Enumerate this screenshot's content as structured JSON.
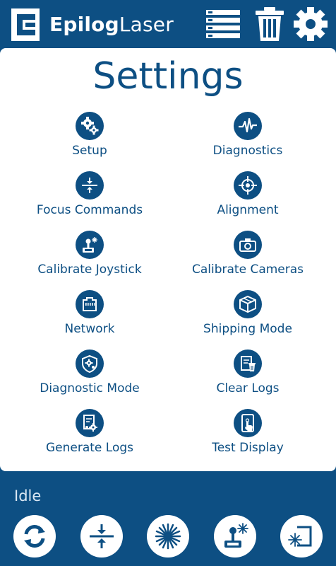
{
  "header": {
    "brand_bold": "Epilog",
    "brand_light": "Laser",
    "logo_icon": "epilog-logo",
    "buttons": [
      {
        "icon": "list-icon"
      },
      {
        "icon": "trash-icon"
      },
      {
        "icon": "gear-icon"
      }
    ]
  },
  "settings": {
    "title": "Settings",
    "items": [
      {
        "label": "Setup",
        "icon": "setup-gears-icon"
      },
      {
        "label": "Diagnostics",
        "icon": "pulse-icon"
      },
      {
        "label": "Focus Commands",
        "icon": "focus-arrows-icon"
      },
      {
        "label": "Alignment",
        "icon": "crosshair-icon"
      },
      {
        "label": "Calibrate Joystick",
        "icon": "joystick-icon"
      },
      {
        "label": "Calibrate Cameras",
        "icon": "camera-icon"
      },
      {
        "label": "Network",
        "icon": "ethernet-port-icon"
      },
      {
        "label": "Shipping Mode",
        "icon": "box-icon"
      },
      {
        "label": "Diagnostic Mode",
        "icon": "shield-gear-icon"
      },
      {
        "label": "Clear Logs",
        "icon": "clear-logs-icon"
      },
      {
        "label": "Generate Logs",
        "icon": "generate-logs-icon"
      },
      {
        "label": "Test Display",
        "icon": "touch-display-icon"
      }
    ]
  },
  "status": {
    "text": "Idle"
  },
  "bottom_bar": [
    {
      "icon": "refresh-icon"
    },
    {
      "icon": "focus-icon"
    },
    {
      "icon": "laser-icon"
    },
    {
      "icon": "joystick-laser-icon"
    },
    {
      "icon": "laser-frame-icon"
    }
  ],
  "colors": {
    "primary": "#0d4f83",
    "panel": "#ffffff",
    "status_text": "#dbe8f4"
  }
}
